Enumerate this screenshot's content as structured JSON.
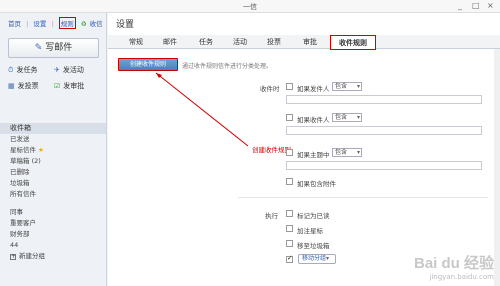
{
  "window": {
    "title": "一信",
    "minimize": "_",
    "maximize": "□",
    "close": "×"
  },
  "sidebar": {
    "topnav": {
      "home": "首页",
      "settings": "设置",
      "rules": "规则",
      "sync": "收信"
    },
    "compose_label": "写邮件",
    "quick_actions": [
      {
        "label": "发任务",
        "icon": "task-icon"
      },
      {
        "label": "发活动",
        "icon": "activity-icon"
      },
      {
        "label": "发投票",
        "icon": "vote-icon"
      },
      {
        "label": "发审批",
        "icon": "approval-icon"
      }
    ],
    "folders_header": "收件箱",
    "folders": [
      "已发送",
      "星标信件",
      "草稿箱 (2)",
      "已删除",
      "垃圾箱",
      "所有信件"
    ],
    "groups": [
      "同事",
      "重要客户",
      "财务部",
      "44"
    ],
    "new_group": "新建分组"
  },
  "main": {
    "heading": "设置",
    "tabs": [
      "常规",
      "邮件",
      "任务",
      "活动",
      "投票",
      "审批",
      "收件规则"
    ],
    "active_tab": "收件规则",
    "create_button": "创建收件规则",
    "create_desc": "通过收件规则信件进行分类处理。",
    "annotation": "创建收件规则",
    "conditions_label": "收件时",
    "conditions": [
      {
        "label": "如果发件人",
        "select": "包含"
      },
      {
        "label": "如果收件人",
        "select": "包含"
      },
      {
        "label": "如果主题中",
        "select": "包含"
      },
      {
        "label": "如果包含附件"
      }
    ],
    "actions_label": "执行",
    "actions": [
      {
        "label": "标记为已读"
      },
      {
        "label": "加注星标"
      },
      {
        "label": "移至垃圾箱"
      }
    ],
    "move_group_select": "移动分组"
  },
  "watermark": {
    "brand": "Bai du 经验",
    "url": "jingyan.baidu.com"
  },
  "colors": {
    "highlight": "#cc0000",
    "link": "#2a5db0",
    "button_blue": "#4a80c0"
  }
}
